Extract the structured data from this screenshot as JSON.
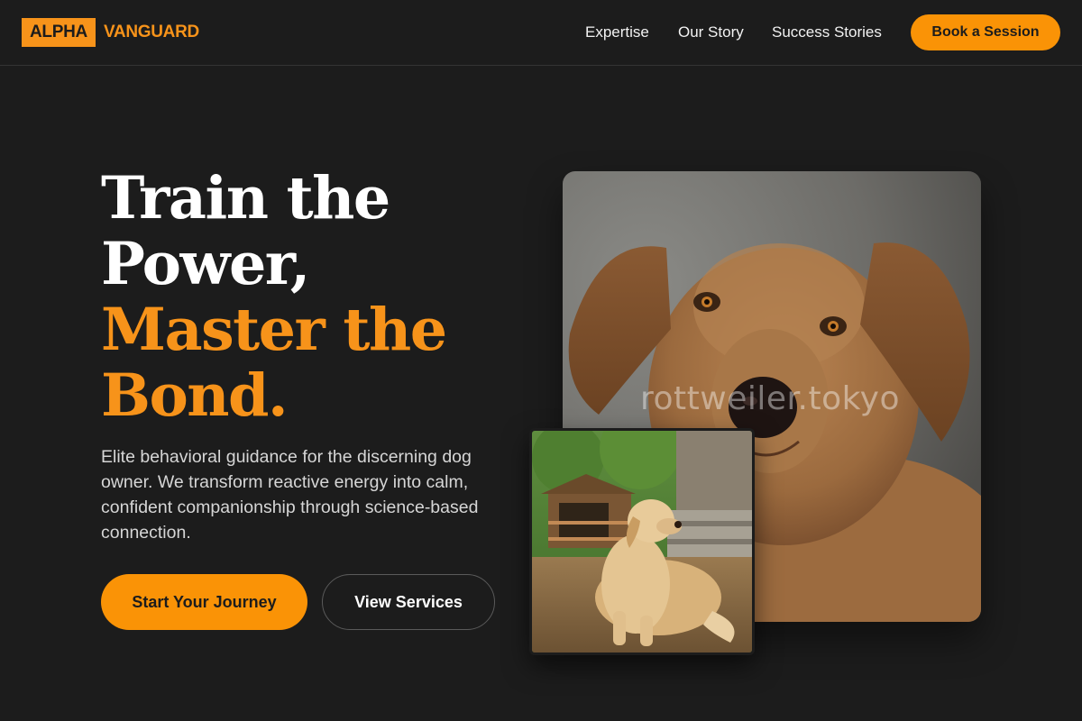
{
  "brand": {
    "box_text": "ALPHA",
    "word_text": "VANGUARD",
    "accent_color": "#f7931a"
  },
  "nav": {
    "items": [
      {
        "label": "Expertise"
      },
      {
        "label": "Our Story"
      },
      {
        "label": "Success Stories"
      }
    ],
    "cta_label": "Book a Session"
  },
  "hero": {
    "title_line1": "Train the",
    "title_line2": "Power,",
    "title_line3": "Master the",
    "title_line4": "Bond.",
    "description": "Elite behavioral guidance for the discerning dog owner. We transform reactive energy into calm, confident companionship through science-based connection.",
    "primary_button": "Start Your Journey",
    "secondary_button": "View Services"
  },
  "images": {
    "main_watermark": "rottweiler.tokyo",
    "main_subject": "dog-portrait-photo",
    "secondary_subject": "golden-retriever-photo"
  }
}
